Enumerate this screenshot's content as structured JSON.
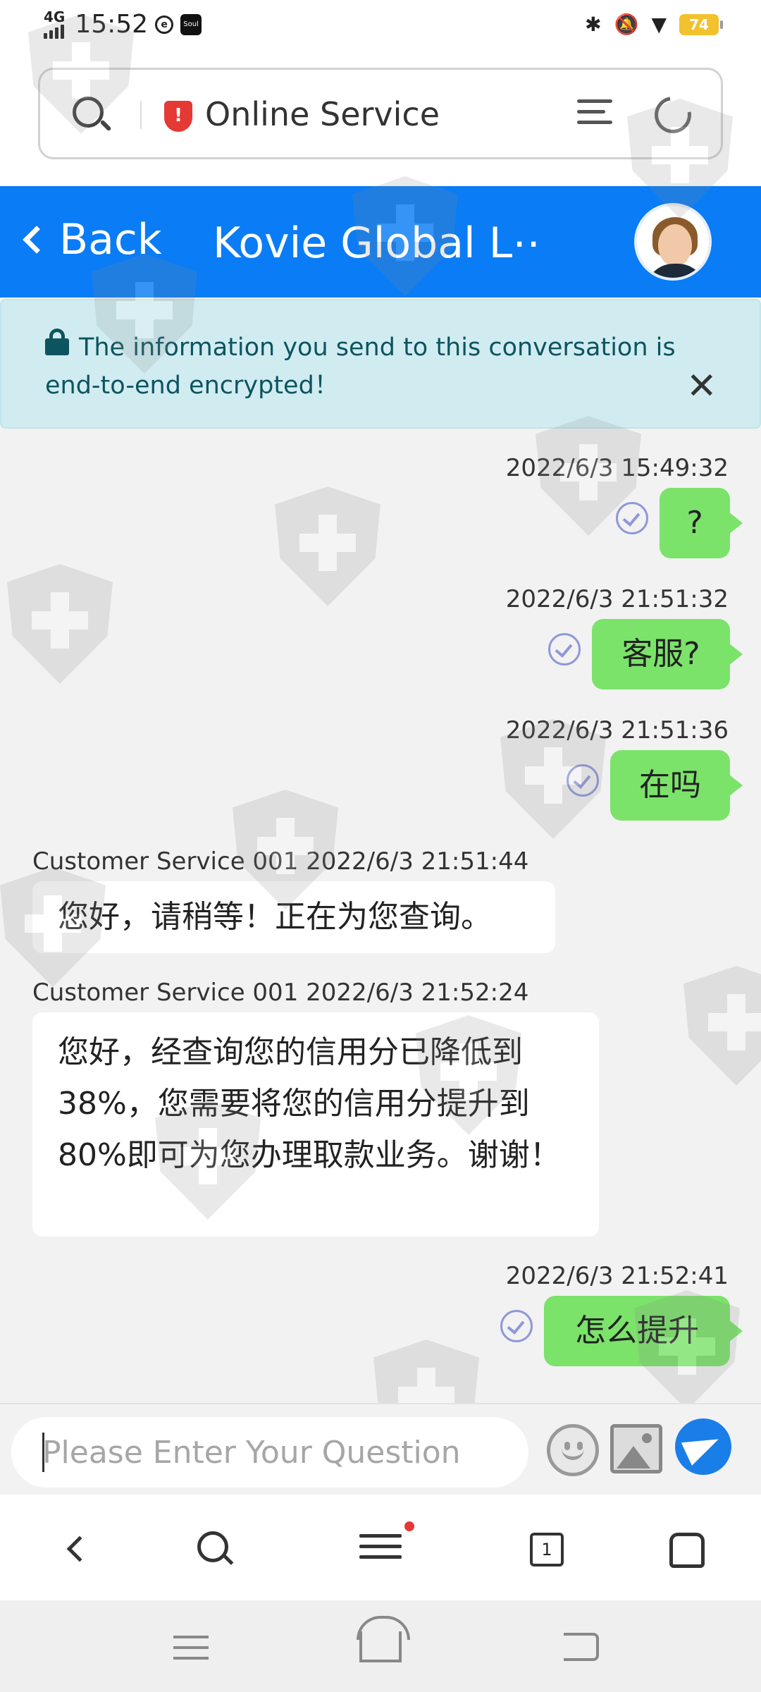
{
  "status_bar": {
    "network": "4G",
    "time": "15:52",
    "app_icon_text": "Soul",
    "battery": "74",
    "icons": [
      "signal-icon",
      "swirl-icon",
      "soul-app-icon",
      "bluetooth-icon",
      "mute-icon",
      "wifi-icon",
      "battery-icon"
    ]
  },
  "url_bar": {
    "title": "Online Service",
    "icons": [
      "search-icon",
      "shield-icon",
      "menu-lines-icon",
      "reload-icon"
    ]
  },
  "chat_header": {
    "back_label": "Back",
    "title": "Kovie Global L⋯",
    "color": "#0a7cf5"
  },
  "notice": {
    "text": "The information you send to this conversation is end-to-end encrypted！",
    "close_glyph": "✕"
  },
  "messages": [
    {
      "direction": "out",
      "time": "2022/6/3 15:49:32",
      "text": "?"
    },
    {
      "direction": "out",
      "time": "2022/6/3 21:51:32",
      "text": "客服?"
    },
    {
      "direction": "out",
      "time": "2022/6/3 21:51:36",
      "text": "在吗"
    },
    {
      "direction": "in",
      "sender_time": "Customer Service 001 2022/6/3 21:51:44",
      "text": "您好，请稍等！正在为您查询。"
    },
    {
      "direction": "in",
      "sender_time": "Customer Service 001 2022/6/3 21:52:24",
      "text": "您好，经查询您的信用分已降低到38%，您需要将您的信用分提升到80%即可为您办理取款业务。谢谢！"
    },
    {
      "direction": "out",
      "time": "2022/6/3 21:52:41",
      "text": "怎么提升"
    }
  ],
  "input": {
    "placeholder": "Please Enter Your Question",
    "value": "",
    "icons": [
      "emoji-icon",
      "image-icon",
      "send-icon"
    ]
  },
  "browser_toolbar": {
    "tab_count": "1",
    "icons": [
      "back-icon",
      "search-icon",
      "menu-icon",
      "tabs-icon",
      "home-icon"
    ]
  },
  "nav_bar": {
    "icons": [
      "recents-icon",
      "home-icon",
      "back-icon"
    ]
  },
  "colors": {
    "outgoing_bubble": "#7be36a",
    "incoming_bubble": "#ffffff",
    "notice_bg": "#d1ecf1",
    "send_button": "#1a7ee8",
    "shield": "#e53935"
  }
}
